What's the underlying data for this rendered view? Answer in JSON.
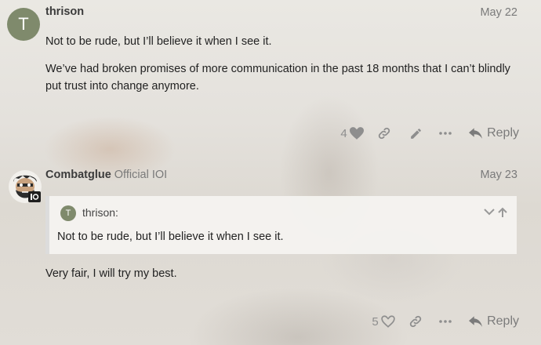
{
  "posts": [
    {
      "avatar_letter": "T",
      "username": "thrison",
      "date": "May 22",
      "paragraphs": [
        "Not to be rude, but I’ll believe it when I see it.",
        "We’ve had broken promises of more communication in the past 18 months that I can’t blindly put trust into change anymore."
      ],
      "like_count": "4",
      "reply_label": "Reply",
      "icons": [
        "heart-icon",
        "link-icon",
        "pencil-icon",
        "more-icon",
        "reply-arrow-icon"
      ]
    },
    {
      "username": "Combatglue",
      "flair": "Official IOI",
      "date": "May 23",
      "quote": {
        "avatar_letter": "T",
        "username": "thrison:",
        "text": "Not to be rude, but I’ll believe it when I see it."
      },
      "paragraphs": [
        "Very fair, I will try my best."
      ],
      "like_count": "5",
      "reply_label": "Reply",
      "icons": [
        "heart-icon",
        "link-icon",
        "more-icon",
        "reply-arrow-icon"
      ]
    }
  ],
  "colors": {
    "avatar_bg": "#7f8a6c",
    "text": "#222222",
    "muted": "#8e8e8e",
    "quote_bg": "#f4f3f0",
    "quote_border": "#dcdcdc"
  }
}
